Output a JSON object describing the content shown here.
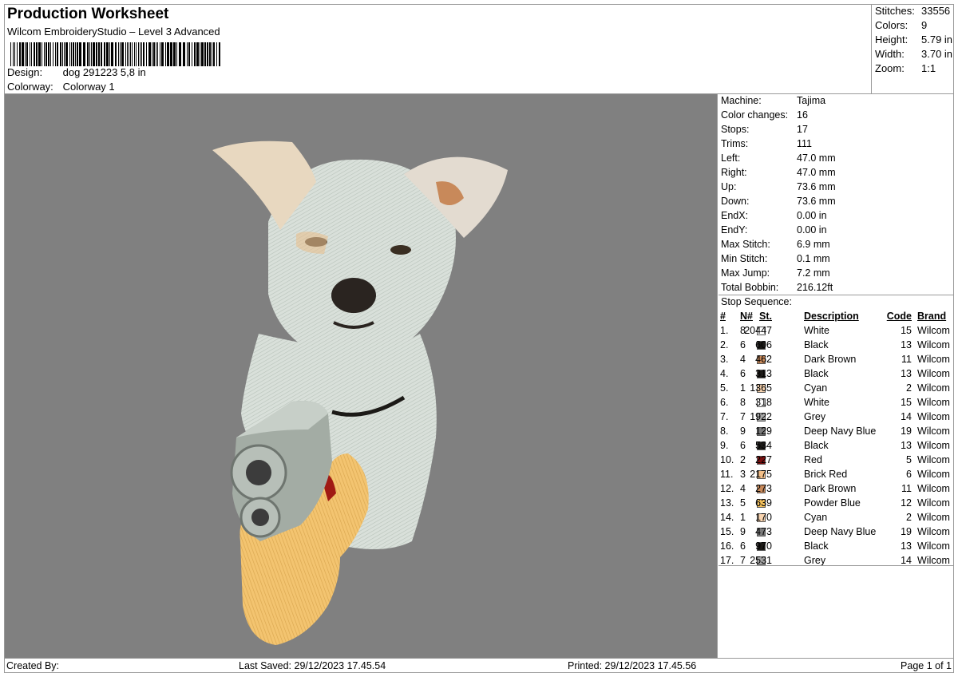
{
  "header": {
    "title": "Production Worksheet",
    "subtitle": "Wilcom EmbroideryStudio – Level 3 Advanced",
    "design_label": "Design:",
    "design_value": "dog 291223 5,8 in",
    "colorway_label": "Colorway:",
    "colorway_value": "Colorway 1"
  },
  "stats": [
    {
      "label": "Stitches:",
      "value": "33556"
    },
    {
      "label": "Colors:",
      "value": "9"
    },
    {
      "label": "Height:",
      "value": "5.79 in"
    },
    {
      "label": "Width:",
      "value": "3.70 in"
    },
    {
      "label": "Zoom:",
      "value": "1:1"
    }
  ],
  "machine_info": [
    {
      "label": "Machine:",
      "value": "Tajima"
    },
    {
      "label": "Color changes:",
      "value": "16"
    },
    {
      "label": "Stops:",
      "value": "17"
    },
    {
      "label": "Trims:",
      "value": "111"
    },
    {
      "label": "Left:",
      "value": "47.0 mm"
    },
    {
      "label": "Right:",
      "value": "47.0 mm"
    },
    {
      "label": "Up:",
      "value": "73.6 mm"
    },
    {
      "label": "Down:",
      "value": "73.6 mm"
    },
    {
      "label": "EndX:",
      "value": "0.00 in"
    },
    {
      "label": "EndY:",
      "value": "0.00 in"
    },
    {
      "label": "Max Stitch:",
      "value": "6.9 mm"
    },
    {
      "label": "Min Stitch:",
      "value": "0.1 mm"
    },
    {
      "label": "Max Jump:",
      "value": "7.2 mm"
    },
    {
      "label": "Total Bobbin:",
      "value": "216.12ft"
    }
  ],
  "stop_sequence": {
    "title": "Stop Sequence:",
    "columns": [
      "#",
      "N#",
      "St.",
      "Description",
      "Code",
      "Brand"
    ],
    "rows": [
      {
        "idx": "1.",
        "n": "8",
        "color": "#ffffff",
        "st": "20447",
        "desc": "White",
        "code": "15",
        "brand": "Wilcom"
      },
      {
        "idx": "2.",
        "n": "6",
        "color": "#1c1a17",
        "st": "606",
        "desc": "Black",
        "code": "13",
        "brand": "Wilcom"
      },
      {
        "idx": "3.",
        "n": "4",
        "color": "#c8895a",
        "st": "462",
        "desc": "Dark Brown",
        "code": "11",
        "brand": "Wilcom"
      },
      {
        "idx": "4.",
        "n": "6",
        "color": "#1c1a17",
        "st": "313",
        "desc": "Black",
        "code": "13",
        "brand": "Wilcom"
      },
      {
        "idx": "5.",
        "n": "1",
        "color": "#f9d5b1",
        "st": "1365",
        "desc": "Cyan",
        "code": "2",
        "brand": "Wilcom"
      },
      {
        "idx": "6.",
        "n": "8",
        "color": "#ffffff",
        "st": "318",
        "desc": "White",
        "code": "15",
        "brand": "Wilcom"
      },
      {
        "idx": "7.",
        "n": "7",
        "color": "#a8a8a8",
        "st": "1922",
        "desc": "Grey",
        "code": "14",
        "brand": "Wilcom"
      },
      {
        "idx": "8.",
        "n": "9",
        "color": "#7c7c7c",
        "st": "129",
        "desc": "Deep Navy Blue",
        "code": "19",
        "brand": "Wilcom"
      },
      {
        "idx": "9.",
        "n": "6",
        "color": "#1c1a17",
        "st": "534",
        "desc": "Black",
        "code": "13",
        "brand": "Wilcom"
      },
      {
        "idx": "10.",
        "n": "2",
        "color": "#7a1010",
        "st": "227",
        "desc": "Red",
        "code": "5",
        "brand": "Wilcom"
      },
      {
        "idx": "11.",
        "n": "3",
        "color": "#f3bf88",
        "st": "2175",
        "desc": "Brick Red",
        "code": "6",
        "brand": "Wilcom"
      },
      {
        "idx": "12.",
        "n": "4",
        "color": "#c8895a",
        "st": "273",
        "desc": "Dark Brown",
        "code": "11",
        "brand": "Wilcom"
      },
      {
        "idx": "13.",
        "n": "5",
        "color": "#f5c25e",
        "st": "639",
        "desc": "Powder Blue",
        "code": "12",
        "brand": "Wilcom"
      },
      {
        "idx": "14.",
        "n": "1",
        "color": "#f9d5b1",
        "st": "170",
        "desc": "Cyan",
        "code": "2",
        "brand": "Wilcom"
      },
      {
        "idx": "15.",
        "n": "9",
        "color": "#7c7c7c",
        "st": "473",
        "desc": "Deep Navy Blue",
        "code": "19",
        "brand": "Wilcom"
      },
      {
        "idx": "16.",
        "n": "6",
        "color": "#1c1a17",
        "st": "970",
        "desc": "Black",
        "code": "13",
        "brand": "Wilcom"
      },
      {
        "idx": "17.",
        "n": "7",
        "color": "#a8a8a8",
        "st": "2531",
        "desc": "Grey",
        "code": "14",
        "brand": "Wilcom"
      }
    ]
  },
  "footer": {
    "created_by": "Created By:",
    "last_saved": "Last Saved: 29/12/2023 17.45.54",
    "printed": "Printed: 29/12/2023 17.45.56",
    "page": "Page 1 of 1"
  },
  "colors": {
    "canvas_bg": "#808080",
    "border": "#9a9a9a"
  }
}
